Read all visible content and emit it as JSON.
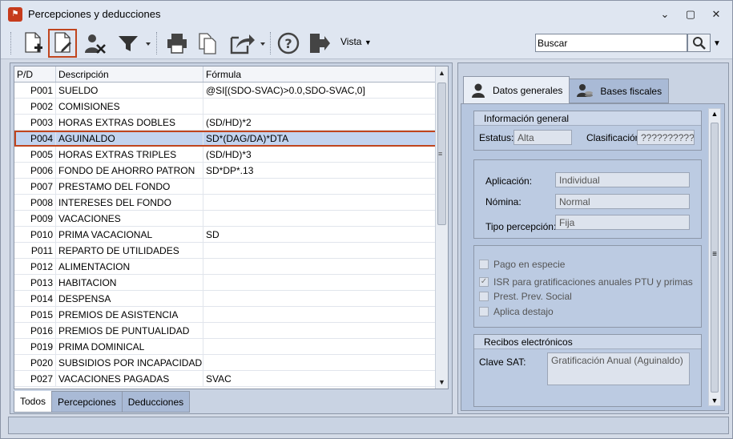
{
  "window": {
    "title": "Percepciones y deducciones",
    "controls": [
      "⌄",
      "▢",
      "✕"
    ]
  },
  "toolbar": {
    "vista_label": "Vista",
    "search_value": "Buscar"
  },
  "grid": {
    "headers": {
      "pd": "P/D",
      "desc": "Descripción",
      "formula": "Fórmula"
    },
    "rows": [
      {
        "pd": "P001",
        "desc": "SUELDO",
        "formula": "@SI[(SDO-SVAC)>0.0,SDO-SVAC,0]"
      },
      {
        "pd": "P002",
        "desc": "COMISIONES",
        "formula": ""
      },
      {
        "pd": "P003",
        "desc": "HORAS EXTRAS DOBLES",
        "formula": "(SD/HD)*2"
      },
      {
        "pd": "P004",
        "desc": "AGUINALDO",
        "formula": "SD*(DAG/DA)*DTA"
      },
      {
        "pd": "P005",
        "desc": "HORAS EXTRAS TRIPLES",
        "formula": "(SD/HD)*3"
      },
      {
        "pd": "P006",
        "desc": "FONDO DE AHORRO PATRON",
        "formula": "SD*DP*.13"
      },
      {
        "pd": "P007",
        "desc": "PRESTAMO DEL FONDO",
        "formula": ""
      },
      {
        "pd": "P008",
        "desc": "INTERESES DEL FONDO",
        "formula": ""
      },
      {
        "pd": "P009",
        "desc": "VACACIONES",
        "formula": ""
      },
      {
        "pd": "P010",
        "desc": "PRIMA VACACIONAL",
        "formula": "SD"
      },
      {
        "pd": "P011",
        "desc": "REPARTO DE UTILIDADES",
        "formula": ""
      },
      {
        "pd": "P012",
        "desc": "ALIMENTACION",
        "formula": ""
      },
      {
        "pd": "P013",
        "desc": "HABITACION",
        "formula": ""
      },
      {
        "pd": "P014",
        "desc": "DESPENSA",
        "formula": ""
      },
      {
        "pd": "P015",
        "desc": "PREMIOS DE ASISTENCIA",
        "formula": ""
      },
      {
        "pd": "P016",
        "desc": "PREMIOS DE PUNTUALIDAD",
        "formula": ""
      },
      {
        "pd": "P019",
        "desc": "PRIMA DOMINICAL",
        "formula": ""
      },
      {
        "pd": "P020",
        "desc": "SUBSIDIOS POR INCAPACIDAD",
        "formula": ""
      },
      {
        "pd": "P027",
        "desc": "VACACIONES PAGADAS",
        "formula": "SVAC"
      }
    ],
    "selected_index": 3
  },
  "bottom_tabs": [
    "Todos",
    "Percepciones",
    "Deducciones"
  ],
  "right": {
    "tabs": [
      "Datos generales",
      "Bases fiscales"
    ],
    "info_general": {
      "title": "Información general",
      "estatus_label": "Estatus:",
      "estatus_value": "Alta",
      "clasif_label": "Clasificación:",
      "clasif_value": "??????????"
    },
    "details": {
      "aplicacion_label": "Aplicación:",
      "aplicacion_value": "Individual",
      "nomina_label": "Nómina:",
      "nomina_value": "Normal",
      "tipo_label": "Tipo percepción:",
      "tipo_value": "Fija"
    },
    "checks": [
      {
        "label": "Pago en especie",
        "checked": false
      },
      {
        "label": "ISR para gratificaciones anuales PTU y primas",
        "checked": true
      },
      {
        "label": "Prest. Prev. Social",
        "checked": false
      },
      {
        "label": "Aplica destajo",
        "checked": false
      }
    ],
    "recibos": {
      "title": "Recibos electrónicos",
      "clave_label": "Clave SAT:",
      "clave_value": "Gratificación Anual (Aguinaldo)"
    }
  },
  "colors": {
    "selection_outline": "#c0451e",
    "selected_row": "#c2d3ef"
  }
}
